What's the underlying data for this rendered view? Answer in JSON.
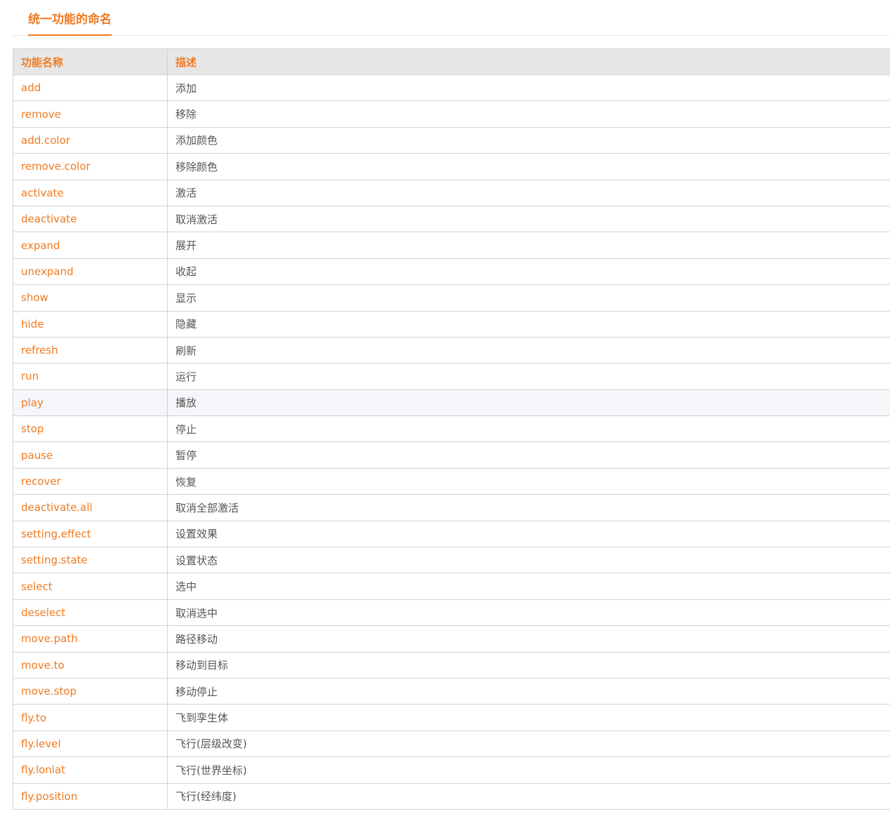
{
  "page": {
    "tab_title": "统一功能的命名"
  },
  "table": {
    "headers": [
      "功能名称",
      "描述"
    ],
    "rows": [
      {
        "name": "add",
        "desc": "添加"
      },
      {
        "name": "remove",
        "desc": "移除"
      },
      {
        "name": "add.color",
        "desc": "添加颜色"
      },
      {
        "name": "remove.color",
        "desc": "移除颜色"
      },
      {
        "name": "activate",
        "desc": "激活"
      },
      {
        "name": "deactivate",
        "desc": "取消激活"
      },
      {
        "name": "expand",
        "desc": "展开"
      },
      {
        "name": "unexpand",
        "desc": "收起"
      },
      {
        "name": "show",
        "desc": "显示"
      },
      {
        "name": "hide",
        "desc": "隐藏"
      },
      {
        "name": "refresh",
        "desc": "刷新"
      },
      {
        "name": "run",
        "desc": "运行"
      },
      {
        "name": "play",
        "desc": "播放"
      },
      {
        "name": "stop",
        "desc": "停止"
      },
      {
        "name": "pause",
        "desc": "暂停"
      },
      {
        "name": "recover",
        "desc": "恢复"
      },
      {
        "name": "deactivate.all",
        "desc": "取消全部激活"
      },
      {
        "name": "setting.effect",
        "desc": "设置效果"
      },
      {
        "name": "setting.state",
        "desc": "设置状态"
      },
      {
        "name": "select",
        "desc": "选中"
      },
      {
        "name": "deselect",
        "desc": "取消选中"
      },
      {
        "name": "move.path",
        "desc": "路径移动"
      },
      {
        "name": "move.to",
        "desc": "移动到目标"
      },
      {
        "name": "move.stop",
        "desc": "移动停止"
      },
      {
        "name": "fly.to",
        "desc": "飞到孪生体"
      },
      {
        "name": "fly.level",
        "desc": "飞行(层级改变)"
      },
      {
        "name": "fly.lonlat",
        "desc": "飞行(世界坐标)"
      },
      {
        "name": "fly.position",
        "desc": "飞行(经纬度)"
      }
    ],
    "highlighted_row": "play"
  },
  "colors": {
    "accent": "#f07a21",
    "header_bg": "#e6e6e6",
    "row_hover_bg": "#f5f6fa",
    "text": "#555555",
    "border": "#d2d2d2"
  }
}
